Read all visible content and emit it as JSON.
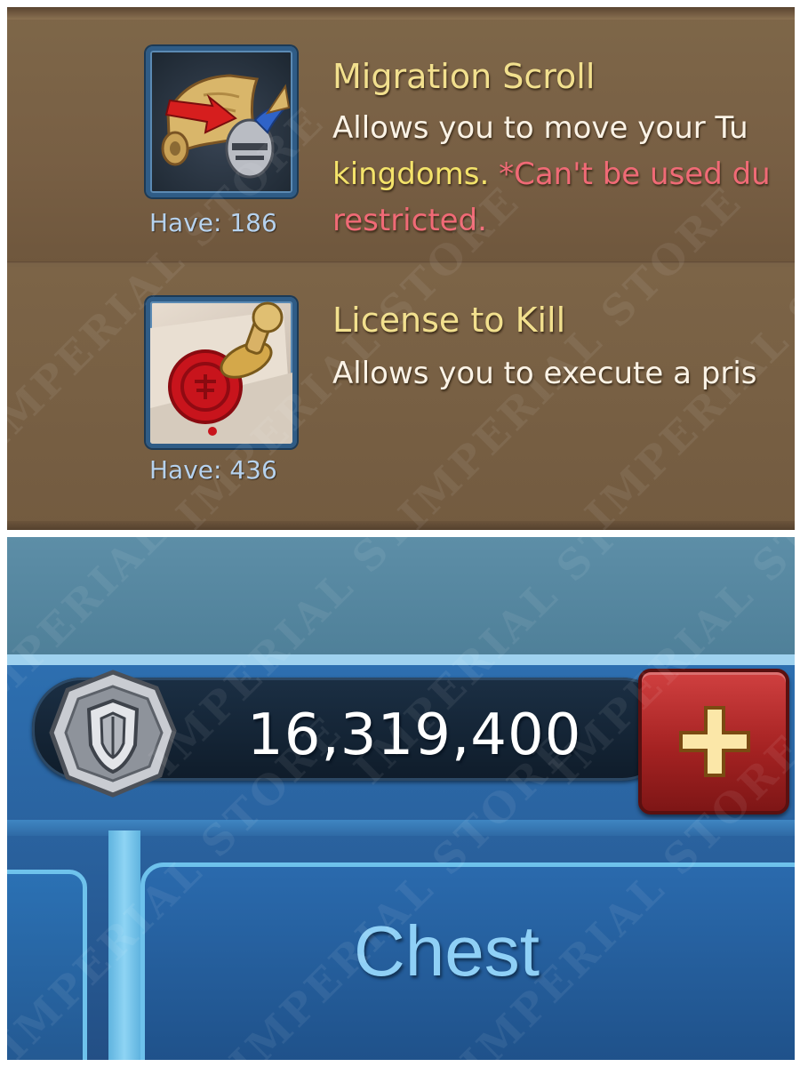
{
  "items": [
    {
      "title": "Migration Scroll",
      "have_label": "Have: 186",
      "icon": "migration-scroll-icon",
      "description": {
        "line1": "Allows you to move your Tu",
        "line2_yellow": "kingdoms.",
        "line2_red": " *Can't be used du",
        "line3_red": "restricted."
      }
    },
    {
      "title": "License to Kill",
      "have_label": "Have: 436",
      "icon": "wax-seal-stamp-icon",
      "description": {
        "line1": "Allows you to execute a pris"
      }
    }
  ],
  "currency": {
    "icon": "shield-coin-icon",
    "value": "16,319,400",
    "add_button_icon": "plus-icon"
  },
  "tabs": {
    "chest_label": "Chest"
  },
  "watermark_text": "IMPERIAL STORE",
  "colors": {
    "title": "#f2e08e",
    "have": "#b6d2ee",
    "highlight_yellow": "#f4e36a",
    "highlight_red": "#f06a76",
    "add_button": "#c0302f",
    "chest_text": "#8fd0f6"
  }
}
